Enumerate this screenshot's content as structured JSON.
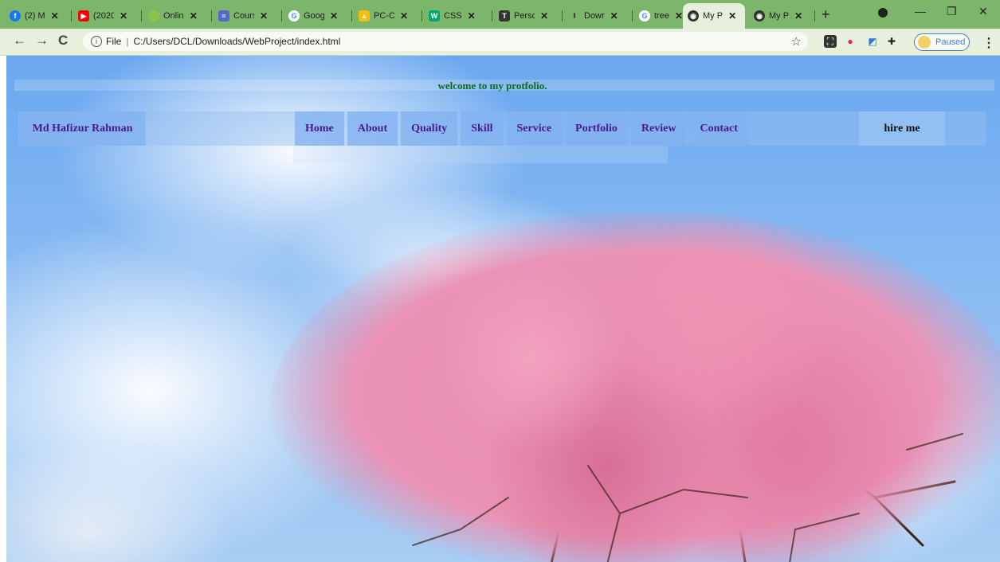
{
  "browser": {
    "tabs": [
      {
        "title": "(2) M",
        "icon": "facebook-icon",
        "color": "#1877f2"
      },
      {
        "title": "(2020",
        "icon": "youtube-icon",
        "color": "#ff0000"
      },
      {
        "title": "Onlin",
        "icon": "android-icon",
        "color": "#8bc34a"
      },
      {
        "title": "Cours",
        "icon": "course-icon",
        "color": "#5566cc"
      },
      {
        "title": "Goog",
        "icon": "google-icon",
        "color": "#4285f4"
      },
      {
        "title": "PC-C",
        "icon": "drive-icon",
        "color": "#fbbc04"
      },
      {
        "title": "CSS",
        "icon": "w3schools-icon",
        "color": "#04aa6d"
      },
      {
        "title": "Perso",
        "icon": "tex-icon",
        "color": "#333333"
      },
      {
        "title": "Dowr",
        "icon": "download-icon",
        "color": "#333333"
      },
      {
        "title": "tree",
        "icon": "google-icon",
        "color": "#4285f4"
      },
      {
        "title": "My P",
        "icon": "globe-icon",
        "color": "#333333",
        "active": true
      },
      {
        "title": "My P",
        "icon": "globe-icon",
        "color": "#333333"
      }
    ],
    "address": {
      "scheme_label": "File",
      "url": "C:/Users/DCL/Downloads/WebProject/index.html"
    },
    "profile_status": "Paused"
  },
  "page": {
    "welcome": "welcome to my protfolio.",
    "brand": "Md Hafizur Rahman",
    "menu": [
      "Home",
      "About",
      "Quality",
      "Skill",
      "Service",
      "Portfolio",
      "Review",
      "Contact"
    ],
    "cta": "hire me"
  },
  "colors": {
    "tabbar": "#7cb66b",
    "toolbar": "#e6f0dc",
    "nav_text": "#4a1a8c",
    "welcome_text": "#0d6b1b"
  }
}
